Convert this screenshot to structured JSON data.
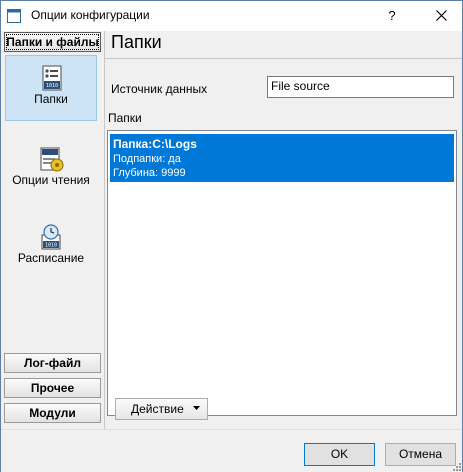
{
  "window": {
    "title": "Опции конфигурации",
    "help_glyph": "?"
  },
  "sidebar": {
    "top_group": "Папки и файлы",
    "items": [
      {
        "label": "Папки",
        "icon": "folder-list-icon",
        "selected": true
      },
      {
        "label": "Опции чтения",
        "icon": "read-options-icon",
        "selected": false
      },
      {
        "label": "Расписание",
        "icon": "schedule-clock-icon",
        "selected": false
      }
    ],
    "bottom_groups": [
      "Лог-файл",
      "Прочее",
      "Модули"
    ]
  },
  "main": {
    "title": "Папки",
    "data_source_label": "Источник данных",
    "data_source_value": "File source",
    "folders_label": "Папки",
    "folders": [
      {
        "path": "Папка:C:\\Logs",
        "subfolders": "Подпапки: да",
        "depth": "Глубина: 9999"
      }
    ],
    "action_button": "Действие"
  },
  "footer": {
    "ok": "OK",
    "cancel": "Отмена"
  },
  "colors": {
    "selection": "#0078d7",
    "nav_selected_bg": "#cde4f7",
    "accent": "#0078d7"
  }
}
